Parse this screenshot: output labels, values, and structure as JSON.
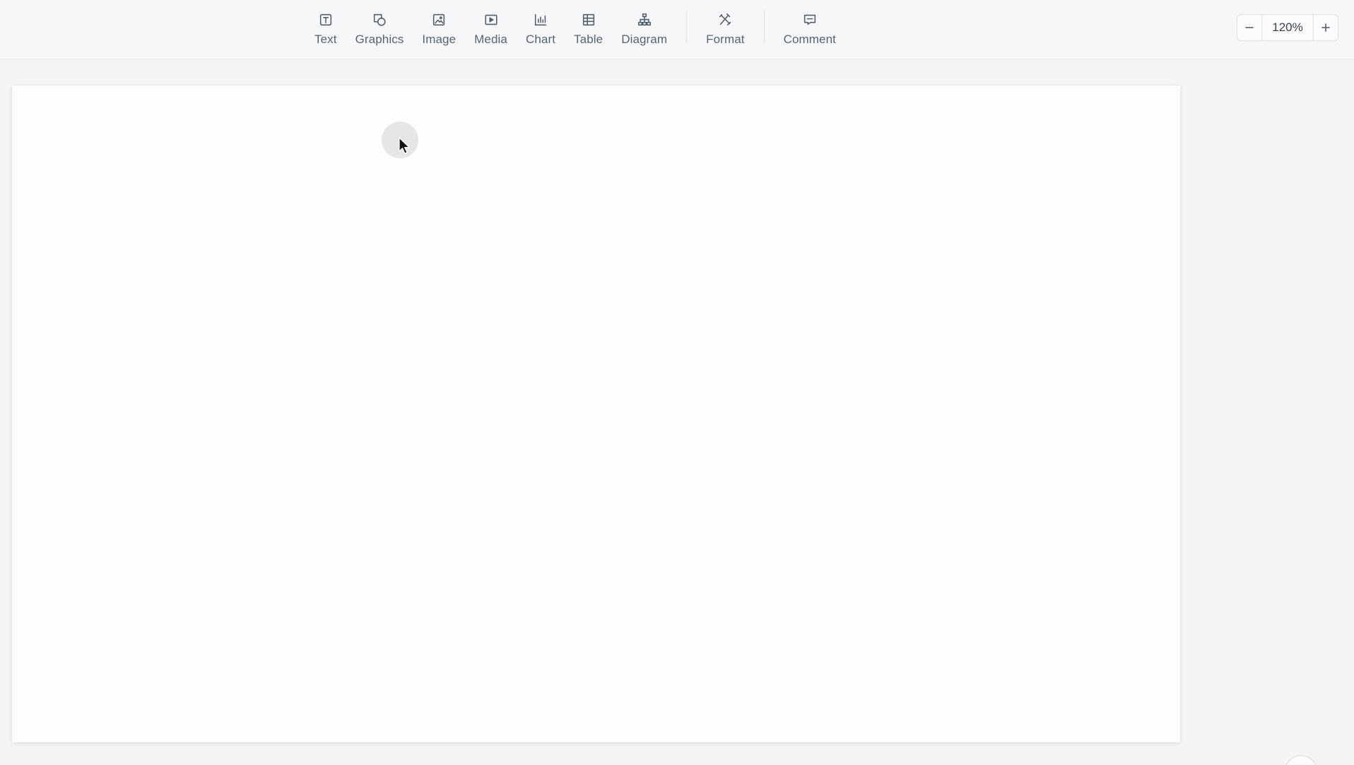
{
  "toolbar": {
    "tools": [
      {
        "label": "Text",
        "icon": "text-box-icon"
      },
      {
        "label": "Graphics",
        "icon": "shapes-icon"
      },
      {
        "label": "Image",
        "icon": "image-icon"
      },
      {
        "label": "Media",
        "icon": "media-play-icon"
      },
      {
        "label": "Chart",
        "icon": "bar-chart-icon"
      },
      {
        "label": "Table",
        "icon": "table-icon"
      },
      {
        "label": "Diagram",
        "icon": "hierarchy-diagram-icon"
      },
      {
        "label": "Format",
        "icon": "format-tools-icon"
      },
      {
        "label": "Comment",
        "icon": "comment-icon"
      }
    ]
  },
  "zoom": {
    "value": "120%",
    "decrease_icon": "minus-icon",
    "increase_icon": "plus-icon"
  },
  "colors": {
    "toolbar_bg": "#f6f7f9",
    "canvas_bg": "#f3f4f6",
    "slide_bg": "#fdfdfe",
    "icon": "#555d6b",
    "label": "#5a6270"
  }
}
